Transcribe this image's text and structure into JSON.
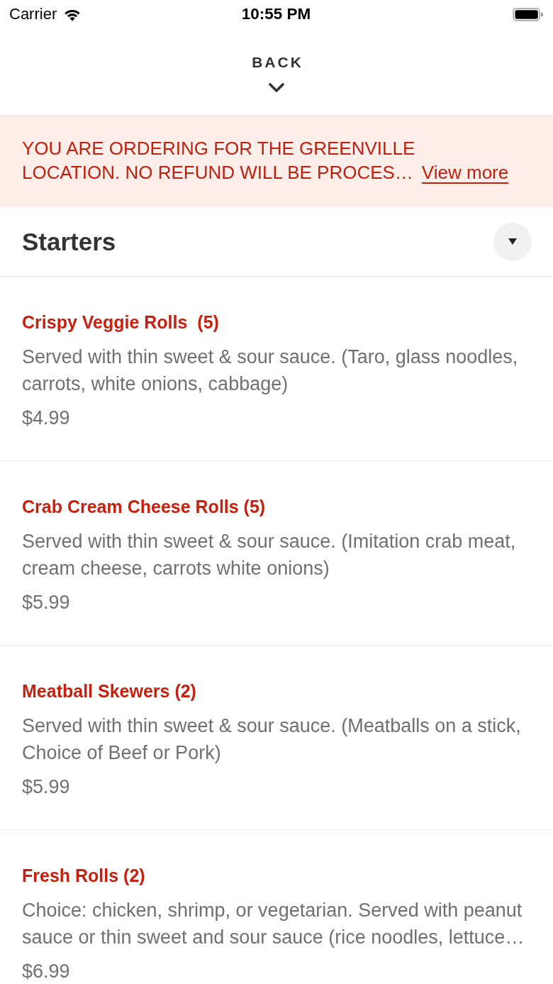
{
  "status_bar": {
    "carrier": "Carrier",
    "time": "10:55 PM"
  },
  "header": {
    "back_label": "BACK"
  },
  "notice": {
    "lines": [
      "YOU ARE ORDERING FOR THE GREENVILLE",
      "LOCATION. NO REFUND WILL BE PROCES…"
    ],
    "link": "View more"
  },
  "category": {
    "title": "Starters"
  },
  "items": [
    {
      "name": "Crispy Veggie Rolls  (5)",
      "description": "Served with thin sweet & sour sauce. (Taro, glass noodles, carrots, white onions, cabbage)",
      "price": "$4.99"
    },
    {
      "name": "Crab Cream Cheese Rolls (5)",
      "description": "Served with thin sweet & sour sauce. (Imitation crab meat, cream cheese, carrots white onions)",
      "price": "$5.99"
    },
    {
      "name": "Meatball Skewers (2)",
      "description": "Served with thin sweet & sour sauce. (Meatballs on a stick, Choice of Beef or Pork)",
      "price": "$5.99"
    },
    {
      "name": "Fresh Rolls (2)",
      "description": "Choice: chicken, shrimp, or vegetarian. Served with peanut sauce or thin sweet and sour sauce (rice noodles, lettuce…",
      "price": "$6.99"
    }
  ]
}
